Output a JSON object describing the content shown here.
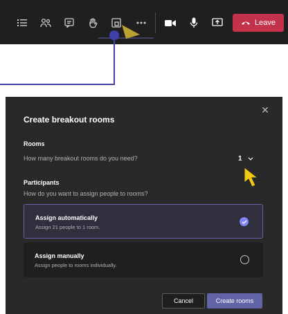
{
  "toolbar": {
    "icons": [
      "list-icon",
      "people-icon",
      "chat-icon",
      "raise-hand-icon",
      "breakout-rooms-icon",
      "more-icon",
      "camera-icon",
      "mic-icon",
      "share-screen-icon"
    ],
    "leave_label": "Leave",
    "leave_color": "#c4314b"
  },
  "dialog": {
    "title": "Create breakout rooms",
    "close_symbol": "✕",
    "rooms": {
      "label": "Rooms",
      "question": "How many breakout rooms do you need?",
      "value": "1"
    },
    "participants": {
      "label": "Participants",
      "question": "How do you want to assign people to rooms?"
    },
    "options": [
      {
        "title": "Assign automatically",
        "subtitle": "Assign 21 people to 1 room.",
        "selected": true
      },
      {
        "title": "Assign manually",
        "subtitle": "Assign people to rooms individually.",
        "selected": false
      }
    ],
    "cancel_label": "Cancel",
    "create_label": "Create rooms",
    "accent_color": "#6264a7"
  }
}
